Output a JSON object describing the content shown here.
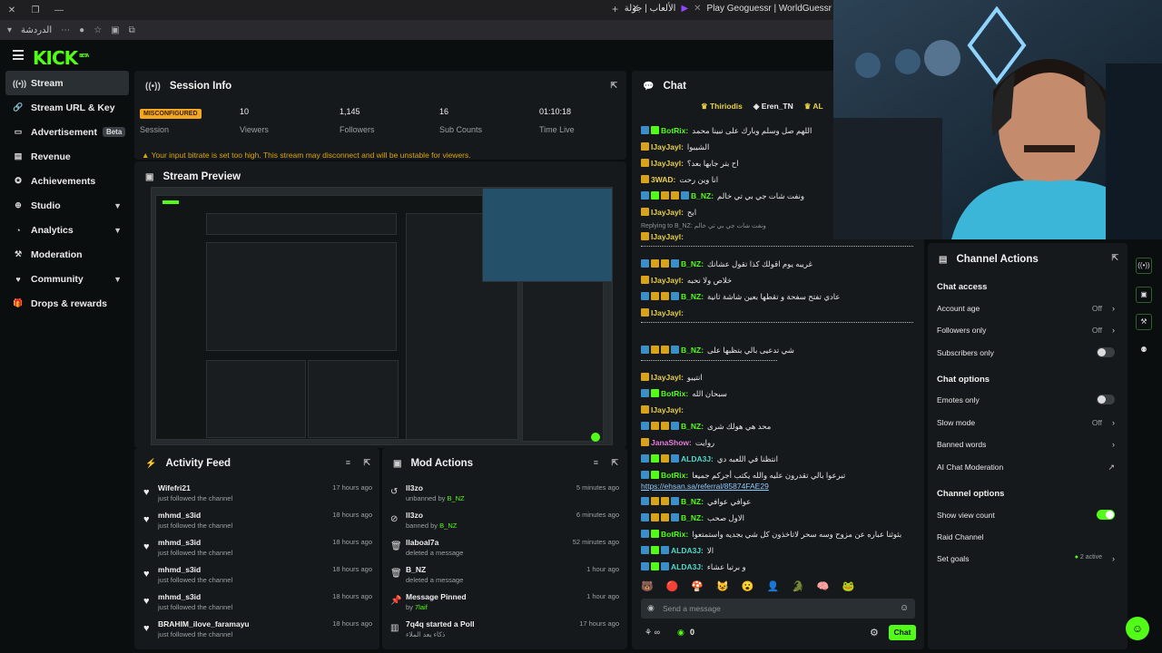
{
  "browser": {
    "tab_title": "Play Geoguessr | WorldGuessr",
    "tab_title_2": "الألعاب | جولة",
    "address_text": "الدردشة"
  },
  "brand": {
    "logo": "KICK",
    "logo_sup": "BETA",
    "accent": "#53fc18"
  },
  "sidebar": {
    "items": [
      {
        "label": "Stream",
        "icon": "broadcast-icon"
      },
      {
        "label": "Stream URL & Key",
        "icon": "link-icon"
      },
      {
        "label": "Advertisement",
        "icon": "tv-icon",
        "badge": "Beta"
      },
      {
        "label": "Revenue",
        "icon": "money-icon"
      },
      {
        "label": "Achievements",
        "icon": "trophy-icon"
      },
      {
        "label": "Studio",
        "icon": "studio-icon"
      },
      {
        "label": "Analytics",
        "icon": "analytics-icon"
      },
      {
        "label": "Moderation",
        "icon": "hammer-icon"
      },
      {
        "label": "Community",
        "icon": "community-icon"
      },
      {
        "label": "Drops & rewards",
        "icon": "gift-icon"
      }
    ]
  },
  "session": {
    "title": "Session Info",
    "status_badge": "MISCONFIGURED",
    "status_label": "Session",
    "viewers": "10",
    "viewers_label": "Viewers",
    "followers": "1,145",
    "followers_label": "Followers",
    "subs": "16",
    "subs_label": "Sub Counts",
    "time": "01:10:18",
    "time_label": "Time Live",
    "warning": "Your input bitrate is set too high. This stream may disconnect and will be unstable for viewers."
  },
  "preview": {
    "title": "Stream Preview"
  },
  "activity": {
    "title": "Activity Feed",
    "items": [
      {
        "name": "Wifefri21",
        "action": "just followed the channel",
        "time": "17 hours ago"
      },
      {
        "name": "mhmd_s3id",
        "action": "just followed the channel",
        "time": "18 hours ago"
      },
      {
        "name": "mhmd_s3id",
        "action": "just followed the channel",
        "time": "18 hours ago"
      },
      {
        "name": "mhmd_s3id",
        "action": "just followed the channel",
        "time": "18 hours ago"
      },
      {
        "name": "mhmd_s3id",
        "action": "just followed the channel",
        "time": "18 hours ago"
      },
      {
        "name": "BRAHIM_ilove_faramayu",
        "action": "just followed the channel",
        "time": "18 hours ago"
      }
    ]
  },
  "mod": {
    "title": "Mod Actions",
    "items": [
      {
        "name": "ll3zo",
        "action": "unbanned by",
        "by": "B_NZ",
        "time": "5 minutes ago",
        "icon": "undo-icon"
      },
      {
        "name": "ll3zo",
        "action": "banned by",
        "by": "B_NZ",
        "time": "6 minutes ago",
        "icon": "ban-icon"
      },
      {
        "name": "llaboal7a",
        "action": "deleted a message",
        "by": "",
        "time": "52 minutes ago",
        "icon": "trash-icon"
      },
      {
        "name": "B_NZ",
        "action": "deleted a message",
        "by": "",
        "time": "1 hour ago",
        "icon": "trash-icon"
      },
      {
        "name": "Message Pinned",
        "action": "by",
        "by": "7laif",
        "time": "1 hour ago",
        "icon": "pin-icon"
      },
      {
        "name": "7q4q started a Poll",
        "action": "ذكاء يعد الملاء",
        "by": "",
        "time": "17 hours ago",
        "icon": "poll-icon"
      }
    ]
  },
  "chat": {
    "title": "Chat",
    "top_gifters": [
      "Thiriodis",
      "Eren_TN",
      "AL"
    ],
    "lines": [
      {
        "user": "BotRix:",
        "cls": "u-green",
        "msg": "اللهم صل وسلم وبارك على نبينا محمد"
      },
      {
        "user": "IJayJayl:",
        "cls": "u-yellow",
        "msg": "الشيبوا"
      },
      {
        "user": "IJayJayl:",
        "cls": "u-yellow",
        "msg": "اح بتر جابها بعد؟"
      },
      {
        "user": "3WAD:",
        "cls": "u-yellow",
        "msg": "انا وين رحت"
      },
      {
        "user": "B_NZ:",
        "cls": "u-green",
        "msg": "ونفت شات جي بي تي خالم"
      },
      {
        "user": "IJayJayl:",
        "cls": "u-yellow",
        "msg": "ابح"
      },
      {
        "user": "IJayJayl:",
        "cls": "u-yellow",
        "msg": ""
      },
      {
        "user": "B_NZ:",
        "cls": "u-green",
        "msg": "غريبه يوم اقولك كذا تقول عشانك"
      },
      {
        "user": "IJayJayl:",
        "cls": "u-yellow",
        "msg": "خلاص ولا نحبه"
      },
      {
        "user": "B_NZ:",
        "cls": "u-green",
        "msg": "عادي تفتح سفحة و تقطها بعين شاشة ثانية"
      },
      {
        "user": "IJayJayl:",
        "cls": "u-yellow",
        "msg": ""
      },
      {
        "user": "B_NZ:",
        "cls": "u-green",
        "msg": "شي تدعيى بالي بتظبها على"
      },
      {
        "user": "IJayJayl:",
        "cls": "u-yellow",
        "msg": "انتيبو"
      },
      {
        "user": "BotRix:",
        "cls": "u-green",
        "msg": "سبحان الله"
      },
      {
        "user": "IJayJayl:",
        "cls": "u-yellow",
        "msg": ""
      },
      {
        "user": "B_NZ:",
        "cls": "u-green",
        "msg": "محد هي هولك شرى"
      },
      {
        "user": "JanaShow:",
        "cls": "u-pink",
        "msg": "روايت"
      },
      {
        "user": "ALDA3J:",
        "cls": "u-teal",
        "msg": "انتظنا في اللعبه دي"
      },
      {
        "user": "BotRix:",
        "cls": "u-green",
        "msg": "تبرعوا بالي تقدرون عليه والله يكتب أجركم جميعا"
      },
      {
        "user": "B_NZ:",
        "cls": "u-green",
        "msg": "عوافي عوافي"
      },
      {
        "user": "B_NZ:",
        "cls": "u-green",
        "msg": "الاول صحب"
      },
      {
        "user": "BotRix:",
        "cls": "u-green",
        "msg": "بثوثنا عباره عن مزوح وسه سحر لاتاخذون كل شي بجديه واستمتعوا"
      },
      {
        "user": "ALDA3J:",
        "cls": "u-teal",
        "msg": "الا"
      },
      {
        "user": "ALDA3J:",
        "cls": "u-teal",
        "msg": "و برتبا عشاء"
      }
    ],
    "reply_note": "Replying to B_NZ: ونفت شات جي بي تي خالم",
    "link": "https://ehsan.sa/referral/85874FAE29",
    "input_placeholder": "Send a message",
    "send_label": "Chat",
    "viewer_count": "0",
    "infinity": "∞"
  },
  "channel_actions": {
    "title": "Channel Actions",
    "sec_access": "Chat access",
    "account_age": "Account age",
    "account_age_val": "Off",
    "followers_only": "Followers only",
    "followers_only_val": "Off",
    "subscribers_only": "Subscribers only",
    "sec_options": "Chat options",
    "emotes_only": "Emotes only",
    "slow_mode": "Slow mode",
    "slow_mode_val": "Off",
    "banned_words": "Banned words",
    "ai_moderation": "AI Chat Moderation",
    "sec_channel": "Channel options",
    "show_view_count": "Show view count",
    "raid_channel": "Raid Channel",
    "set_goals": "Set goals",
    "set_goals_val": "2 active"
  }
}
